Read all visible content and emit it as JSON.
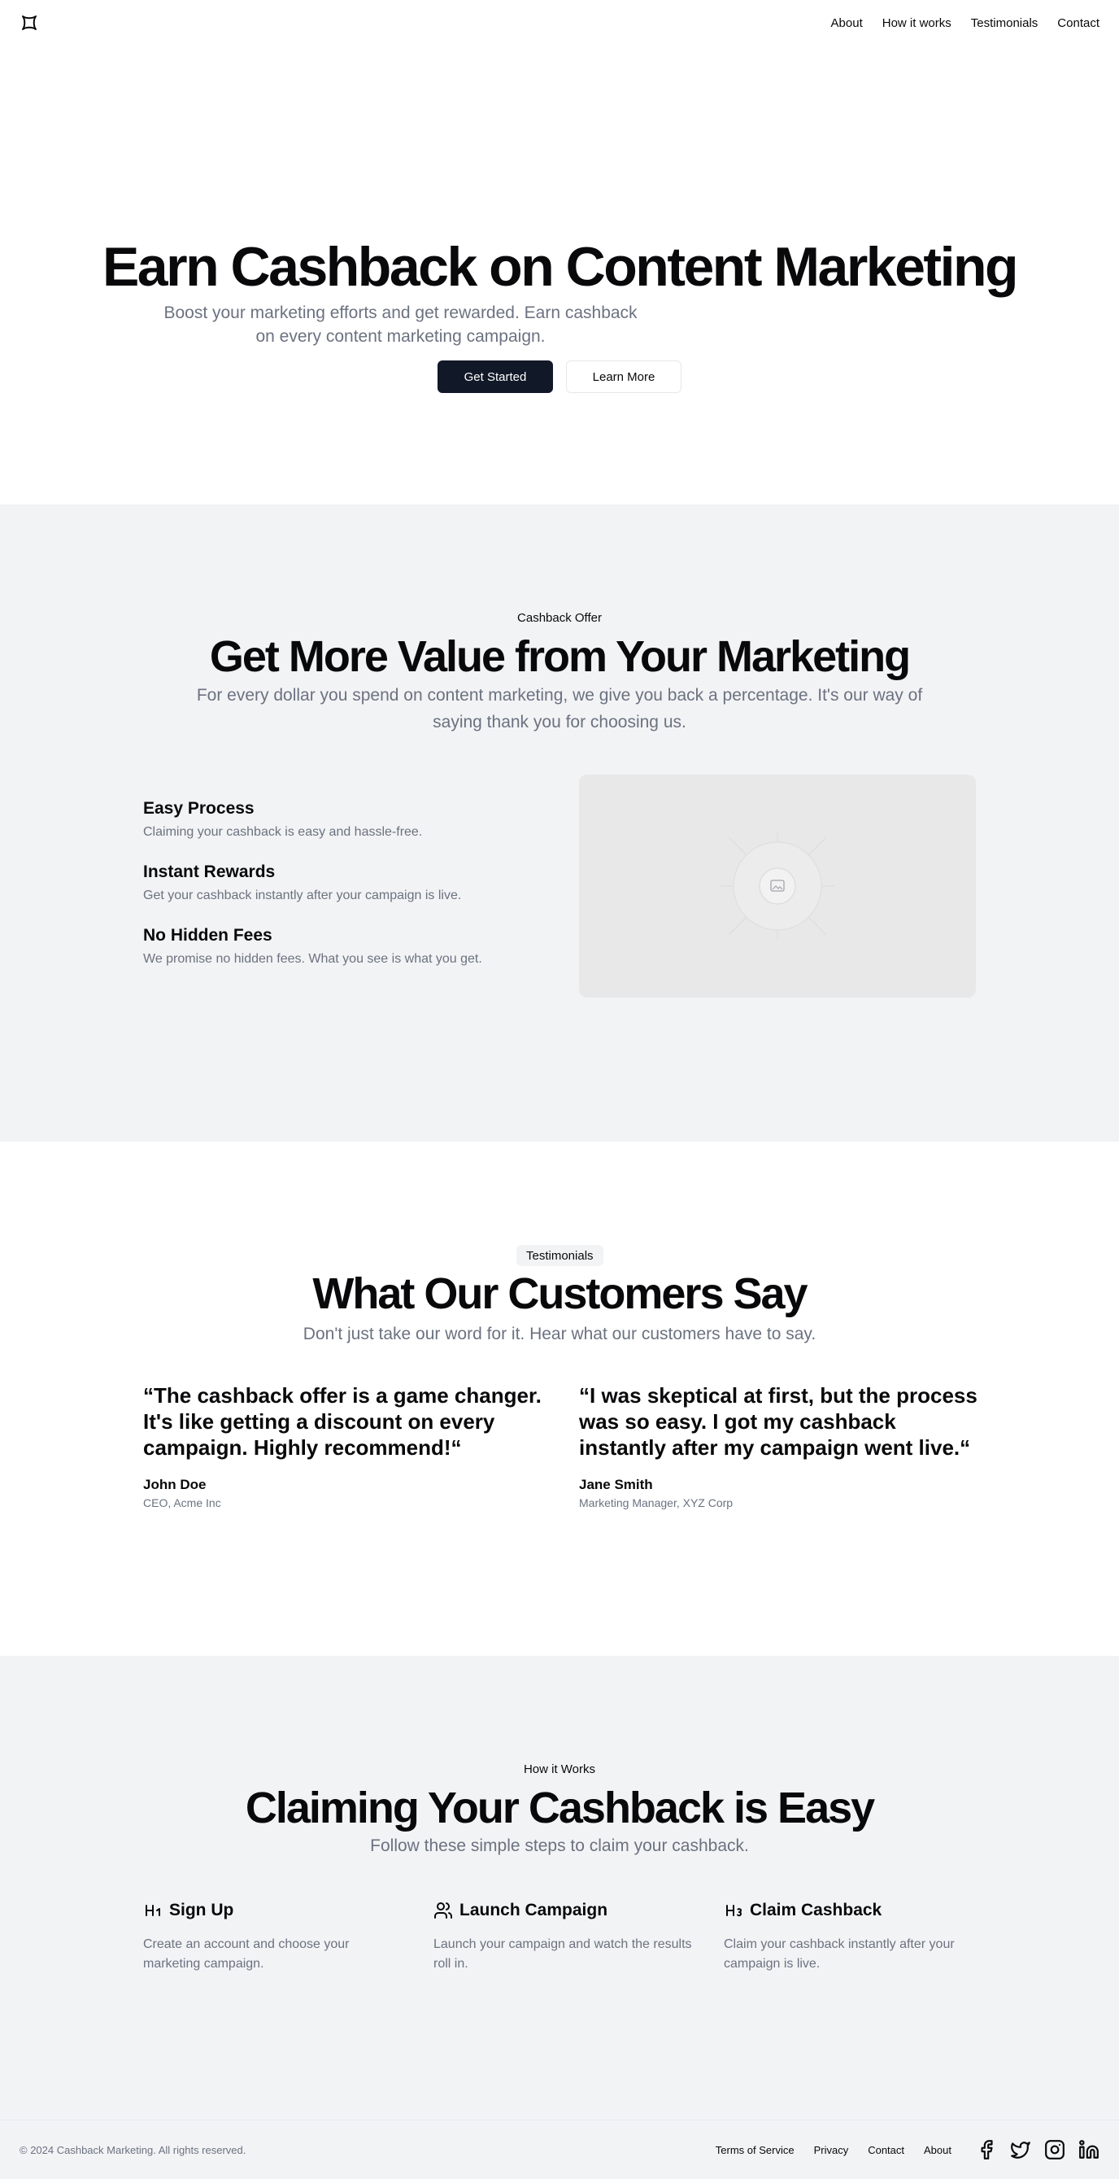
{
  "nav": {
    "items": [
      "About",
      "How it works",
      "Testimonials",
      "Contact"
    ]
  },
  "hero": {
    "title": "Earn Cashback on Content Marketing",
    "subtitle": "Boost your marketing efforts and get rewarded. Earn cashback on every content marketing campaign.",
    "primary_button": "Get Started",
    "secondary_button": "Learn More"
  },
  "offer": {
    "eyebrow": "Cashback Offer",
    "title": "Get More Value from Your Marketing",
    "description": "For every dollar you spend on content marketing, we give you back a percentage. It's our way of saying thank you for choosing us.",
    "features": [
      {
        "title": "Easy Process",
        "text": "Claiming your cashback is easy and hassle-free."
      },
      {
        "title": "Instant Rewards",
        "text": "Get your cashback instantly after your campaign is live."
      },
      {
        "title": "No Hidden Fees",
        "text": "We promise no hidden fees. What you see is what you get."
      }
    ]
  },
  "testimonials": {
    "badge": "Testimonials",
    "title": "What Our Customers Say",
    "description": "Don't just take our word for it. Hear what our customers have to say.",
    "items": [
      {
        "quote": "“The cashback offer is a game changer. It's like getting a discount on every campaign. Highly recommend!“",
        "name": "John Doe",
        "role": "CEO, Acme Inc"
      },
      {
        "quote": "“I was skeptical at first, but the process was so easy. I got my cashback instantly after my campaign went live.“",
        "name": "Jane Smith",
        "role": "Marketing Manager, XYZ Corp"
      }
    ]
  },
  "how": {
    "eyebrow": "How it Works",
    "title": "Claiming Your Cashback is Easy",
    "description": "Follow these simple steps to claim your cashback.",
    "steps": [
      {
        "title": "Sign Up",
        "text": "Create an account and choose your marketing campaign.",
        "icon": "heading-1-icon"
      },
      {
        "title": "Launch Campaign",
        "text": "Launch your campaign and watch the results roll in.",
        "icon": "users-icon"
      },
      {
        "title": "Claim Cashback",
        "text": "Claim your cashback instantly after your campaign is live.",
        "icon": "heading-3-icon"
      }
    ]
  },
  "footer": {
    "copyright": "© 2024 Cashback Marketing. All rights reserved.",
    "links": [
      "Terms of Service",
      "Privacy",
      "Contact",
      "About"
    ],
    "social": [
      "facebook-icon",
      "twitter-icon",
      "instagram-icon",
      "linkedin-icon"
    ]
  }
}
